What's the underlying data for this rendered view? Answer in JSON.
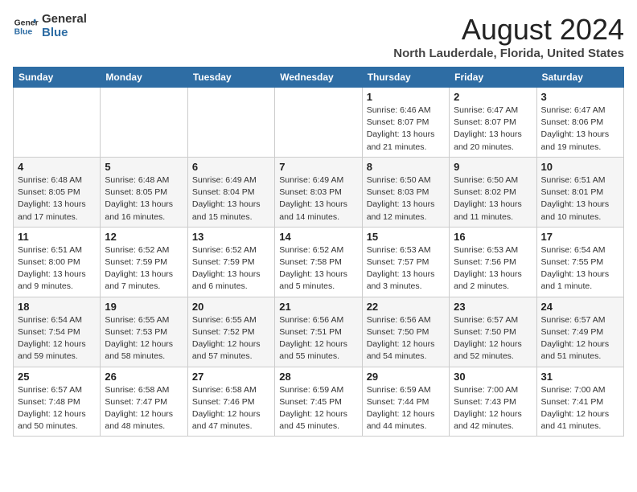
{
  "logo": {
    "line1": "General",
    "line2": "Blue"
  },
  "title": "August 2024",
  "location": "North Lauderdale, Florida, United States",
  "days_of_week": [
    "Sunday",
    "Monday",
    "Tuesday",
    "Wednesday",
    "Thursday",
    "Friday",
    "Saturday"
  ],
  "weeks": [
    [
      {
        "day": "",
        "info": ""
      },
      {
        "day": "",
        "info": ""
      },
      {
        "day": "",
        "info": ""
      },
      {
        "day": "",
        "info": ""
      },
      {
        "day": "1",
        "info": "Sunrise: 6:46 AM\nSunset: 8:07 PM\nDaylight: 13 hours\nand 21 minutes."
      },
      {
        "day": "2",
        "info": "Sunrise: 6:47 AM\nSunset: 8:07 PM\nDaylight: 13 hours\nand 20 minutes."
      },
      {
        "day": "3",
        "info": "Sunrise: 6:47 AM\nSunset: 8:06 PM\nDaylight: 13 hours\nand 19 minutes."
      }
    ],
    [
      {
        "day": "4",
        "info": "Sunrise: 6:48 AM\nSunset: 8:05 PM\nDaylight: 13 hours\nand 17 minutes."
      },
      {
        "day": "5",
        "info": "Sunrise: 6:48 AM\nSunset: 8:05 PM\nDaylight: 13 hours\nand 16 minutes."
      },
      {
        "day": "6",
        "info": "Sunrise: 6:49 AM\nSunset: 8:04 PM\nDaylight: 13 hours\nand 15 minutes."
      },
      {
        "day": "7",
        "info": "Sunrise: 6:49 AM\nSunset: 8:03 PM\nDaylight: 13 hours\nand 14 minutes."
      },
      {
        "day": "8",
        "info": "Sunrise: 6:50 AM\nSunset: 8:03 PM\nDaylight: 13 hours\nand 12 minutes."
      },
      {
        "day": "9",
        "info": "Sunrise: 6:50 AM\nSunset: 8:02 PM\nDaylight: 13 hours\nand 11 minutes."
      },
      {
        "day": "10",
        "info": "Sunrise: 6:51 AM\nSunset: 8:01 PM\nDaylight: 13 hours\nand 10 minutes."
      }
    ],
    [
      {
        "day": "11",
        "info": "Sunrise: 6:51 AM\nSunset: 8:00 PM\nDaylight: 13 hours\nand 9 minutes."
      },
      {
        "day": "12",
        "info": "Sunrise: 6:52 AM\nSunset: 7:59 PM\nDaylight: 13 hours\nand 7 minutes."
      },
      {
        "day": "13",
        "info": "Sunrise: 6:52 AM\nSunset: 7:59 PM\nDaylight: 13 hours\nand 6 minutes."
      },
      {
        "day": "14",
        "info": "Sunrise: 6:52 AM\nSunset: 7:58 PM\nDaylight: 13 hours\nand 5 minutes."
      },
      {
        "day": "15",
        "info": "Sunrise: 6:53 AM\nSunset: 7:57 PM\nDaylight: 13 hours\nand 3 minutes."
      },
      {
        "day": "16",
        "info": "Sunrise: 6:53 AM\nSunset: 7:56 PM\nDaylight: 13 hours\nand 2 minutes."
      },
      {
        "day": "17",
        "info": "Sunrise: 6:54 AM\nSunset: 7:55 PM\nDaylight: 13 hours\nand 1 minute."
      }
    ],
    [
      {
        "day": "18",
        "info": "Sunrise: 6:54 AM\nSunset: 7:54 PM\nDaylight: 12 hours\nand 59 minutes."
      },
      {
        "day": "19",
        "info": "Sunrise: 6:55 AM\nSunset: 7:53 PM\nDaylight: 12 hours\nand 58 minutes."
      },
      {
        "day": "20",
        "info": "Sunrise: 6:55 AM\nSunset: 7:52 PM\nDaylight: 12 hours\nand 57 minutes."
      },
      {
        "day": "21",
        "info": "Sunrise: 6:56 AM\nSunset: 7:51 PM\nDaylight: 12 hours\nand 55 minutes."
      },
      {
        "day": "22",
        "info": "Sunrise: 6:56 AM\nSunset: 7:50 PM\nDaylight: 12 hours\nand 54 minutes."
      },
      {
        "day": "23",
        "info": "Sunrise: 6:57 AM\nSunset: 7:50 PM\nDaylight: 12 hours\nand 52 minutes."
      },
      {
        "day": "24",
        "info": "Sunrise: 6:57 AM\nSunset: 7:49 PM\nDaylight: 12 hours\nand 51 minutes."
      }
    ],
    [
      {
        "day": "25",
        "info": "Sunrise: 6:57 AM\nSunset: 7:48 PM\nDaylight: 12 hours\nand 50 minutes."
      },
      {
        "day": "26",
        "info": "Sunrise: 6:58 AM\nSunset: 7:47 PM\nDaylight: 12 hours\nand 48 minutes."
      },
      {
        "day": "27",
        "info": "Sunrise: 6:58 AM\nSunset: 7:46 PM\nDaylight: 12 hours\nand 47 minutes."
      },
      {
        "day": "28",
        "info": "Sunrise: 6:59 AM\nSunset: 7:45 PM\nDaylight: 12 hours\nand 45 minutes."
      },
      {
        "day": "29",
        "info": "Sunrise: 6:59 AM\nSunset: 7:44 PM\nDaylight: 12 hours\nand 44 minutes."
      },
      {
        "day": "30",
        "info": "Sunrise: 7:00 AM\nSunset: 7:43 PM\nDaylight: 12 hours\nand 42 minutes."
      },
      {
        "day": "31",
        "info": "Sunrise: 7:00 AM\nSunset: 7:41 PM\nDaylight: 12 hours\nand 41 minutes."
      }
    ]
  ]
}
